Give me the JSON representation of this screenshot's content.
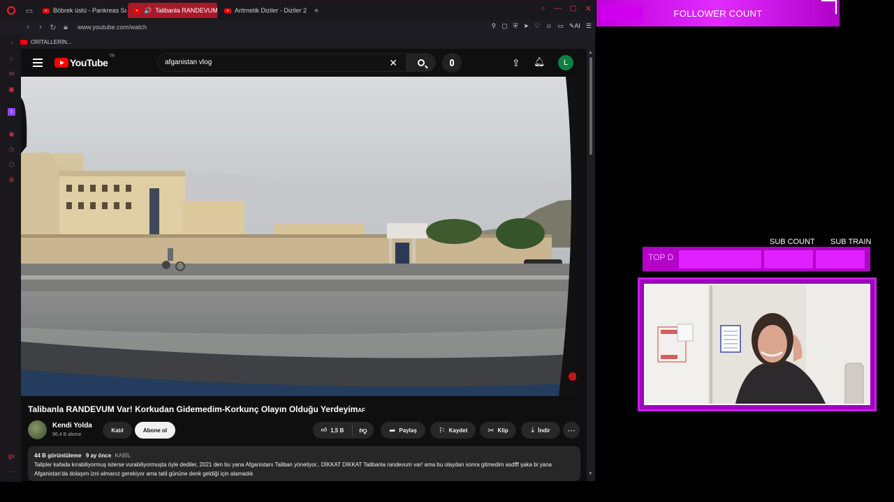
{
  "browser": {
    "tabs": [
      {
        "label": "Böbrek üstü - Pankreas Sa",
        "active": false
      },
      {
        "label": "Talibanla RANDEVUM",
        "active": true
      },
      {
        "label": "Aritmetik Diziler - Diziler 2",
        "active": false
      }
    ],
    "url": "www.youtube.com/watch",
    "ai_label": "AI",
    "bookmark": "ORİTALLERİN...",
    "new_tab_icon": "plus-icon"
  },
  "youtube": {
    "country_code": "TR",
    "logo_text": "YouTube",
    "search_value": "afganistan vlog",
    "avatar_letter": "L",
    "video_title": "Talibanla RANDEVUM Var! Korkudan Gidemedim-Korkunç Olayın Olduğu Yerdeyim",
    "title_suffix": "AF",
    "channel_name": "Kendi Yolda",
    "subscribers": "96,4 B abone",
    "join_label": "Katıl",
    "subscribe_label": "Abone ol",
    "likes": "1,5 B",
    "share_label": "Paylaş",
    "save_label": "Kaydet",
    "clip_label": "Klip",
    "download_label": "İndir",
    "views": "44 B görüntüleme",
    "age": "9 ay önce",
    "location": "KABİL",
    "description": "Talipler kafada kırabiliyormuş isterse vurabiliyormuşta öyle dediler, 2021 den bu yana Afganistanı Taliban yönetiyor.. DİKKAT DİKKAT Talibanla randevum var! ama bu olaydan sonra gitmedim asdfff şaka bi yana Afganistan'da dolaşım izni almanız gerekiyor ama tatil gününe denk geldiği için alamadık"
  },
  "overlay": {
    "follower_label": "FOLLOWER COUNT",
    "sub_count_label": "SUB COUNT",
    "sub_train_label": "SUB TRAIN",
    "top_label": "TOP D",
    "accent_color": "#c000d8"
  }
}
